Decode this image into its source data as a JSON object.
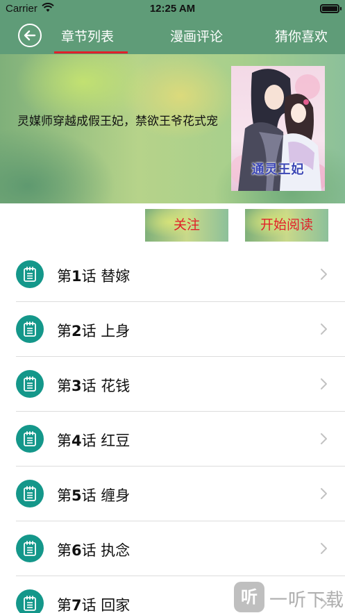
{
  "status_bar": {
    "carrier": "Carrier",
    "time": "12:25 AM",
    "battery_level": 1.0
  },
  "nav": {
    "back_icon": "arrow-left-circle-icon",
    "tabs": [
      {
        "label": "章节列表",
        "active": true
      },
      {
        "label": "漫画评论",
        "active": false
      },
      {
        "label": "猜你喜欢",
        "active": false
      }
    ],
    "accent_color": "#e0202a",
    "bar_color": "#5f9c78"
  },
  "banner": {
    "title": "灵媒师穿越成假王妃，禁欲王爷花式宠",
    "cover_title": "通灵王妃"
  },
  "actions": {
    "follow_label": "关注",
    "read_label": "开始阅读"
  },
  "chapters": [
    {
      "num": "1",
      "label": "话 替嫁"
    },
    {
      "num": "2",
      "label": "话 上身"
    },
    {
      "num": "3",
      "label": "话 花钱"
    },
    {
      "num": "4",
      "label": "话 红豆"
    },
    {
      "num": "5",
      "label": "话 缠身"
    },
    {
      "num": "6",
      "label": "话 执念"
    },
    {
      "num": "7",
      "label": "话 回家"
    }
  ],
  "chapter_prefix": "第",
  "chapter_icon": "notebook-icon",
  "chapter_icon_color": "#14978a",
  "watermark": {
    "logo_text": "听",
    "text": "一听下载"
  }
}
